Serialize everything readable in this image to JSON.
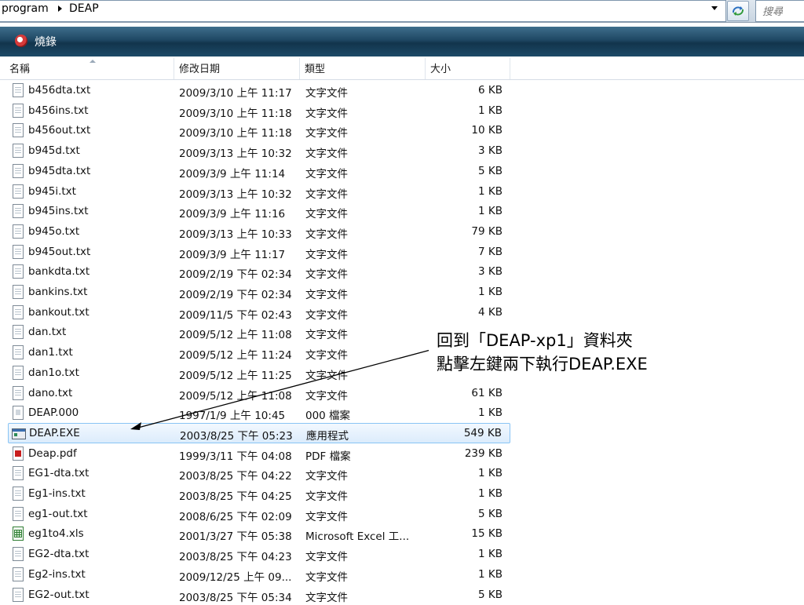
{
  "address": {
    "crumbs": [
      "program",
      "DEAP"
    ],
    "search_placeholder": "搜尋"
  },
  "toolbar": {
    "burn_label": "燒錄"
  },
  "columns": {
    "name": "名稱",
    "date": "修改日期",
    "type": "類型",
    "size": "大小"
  },
  "files": [
    {
      "name": "b456dta.txt",
      "date": "2009/3/10 上午 11:17",
      "type": "文字文件",
      "size": "6 KB",
      "icon": "text-file-icon"
    },
    {
      "name": "b456ins.txt",
      "date": "2009/3/10 上午 11:18",
      "type": "文字文件",
      "size": "1 KB",
      "icon": "text-file-icon"
    },
    {
      "name": "b456out.txt",
      "date": "2009/3/10 上午 11:18",
      "type": "文字文件",
      "size": "10 KB",
      "icon": "text-file-icon"
    },
    {
      "name": "b945d.txt",
      "date": "2009/3/13 上午 10:32",
      "type": "文字文件",
      "size": "3 KB",
      "icon": "text-file-icon"
    },
    {
      "name": "b945dta.txt",
      "date": "2009/3/9 上午 11:14",
      "type": "文字文件",
      "size": "5 KB",
      "icon": "text-file-icon"
    },
    {
      "name": "b945i.txt",
      "date": "2009/3/13 上午 10:32",
      "type": "文字文件",
      "size": "1 KB",
      "icon": "text-file-icon"
    },
    {
      "name": "b945ins.txt",
      "date": "2009/3/9 上午 11:16",
      "type": "文字文件",
      "size": "1 KB",
      "icon": "text-file-icon"
    },
    {
      "name": "b945o.txt",
      "date": "2009/3/13 上午 10:33",
      "type": "文字文件",
      "size": "79 KB",
      "icon": "text-file-icon"
    },
    {
      "name": "b945out.txt",
      "date": "2009/3/9 上午 11:17",
      "type": "文字文件",
      "size": "7 KB",
      "icon": "text-file-icon"
    },
    {
      "name": "bankdta.txt",
      "date": "2009/2/19 下午 02:34",
      "type": "文字文件",
      "size": "3 KB",
      "icon": "text-file-icon"
    },
    {
      "name": "bankins.txt",
      "date": "2009/2/19 下午 02:34",
      "type": "文字文件",
      "size": "1 KB",
      "icon": "text-file-icon"
    },
    {
      "name": "bankout.txt",
      "date": "2009/11/5 下午 02:43",
      "type": "文字文件",
      "size": "4 KB",
      "icon": "text-file-icon"
    },
    {
      "name": "dan.txt",
      "date": "2009/5/12 上午 11:08",
      "type": "文字文件",
      "size": "",
      "icon": "text-file-icon"
    },
    {
      "name": "dan1.txt",
      "date": "2009/5/12 上午 11:24",
      "type": "文字文件",
      "size": "",
      "icon": "text-file-icon"
    },
    {
      "name": "dan1o.txt",
      "date": "2009/5/12 上午 11:25",
      "type": "文字文件",
      "size": "",
      "icon": "text-file-icon"
    },
    {
      "name": "dano.txt",
      "date": "2009/5/12 上午 11:08",
      "type": "文字文件",
      "size": "61 KB",
      "icon": "text-file-icon"
    },
    {
      "name": "DEAP.000",
      "date": "1997/1/9 上午 10:45",
      "type": "000 檔案",
      "size": "1 KB",
      "icon": "generic-file-icon"
    },
    {
      "name": "DEAP.EXE",
      "date": "2003/8/25 下午 05:23",
      "type": "應用程式",
      "size": "549 KB",
      "icon": "application-icon",
      "selected": true
    },
    {
      "name": "Deap.pdf",
      "date": "1999/3/11 下午 04:08",
      "type": "PDF 檔案",
      "size": "239 KB",
      "icon": "pdf-file-icon"
    },
    {
      "name": "EG1-dta.txt",
      "date": "2003/8/25 下午 04:22",
      "type": "文字文件",
      "size": "1 KB",
      "icon": "text-file-icon"
    },
    {
      "name": "Eg1-ins.txt",
      "date": "2003/8/25 下午 04:25",
      "type": "文字文件",
      "size": "1 KB",
      "icon": "text-file-icon"
    },
    {
      "name": "eg1-out.txt",
      "date": "2008/6/25 下午 02:09",
      "type": "文字文件",
      "size": "5 KB",
      "icon": "text-file-icon"
    },
    {
      "name": "eg1to4.xls",
      "date": "2001/3/27 下午 05:38",
      "type": "Microsoft Excel 工...",
      "size": "15 KB",
      "icon": "excel-file-icon"
    },
    {
      "name": "EG2-dta.txt",
      "date": "2003/8/25 下午 04:23",
      "type": "文字文件",
      "size": "1 KB",
      "icon": "text-file-icon"
    },
    {
      "name": "Eg2-ins.txt",
      "date": "2009/12/25 上午 09...",
      "type": "文字文件",
      "size": "1 KB",
      "icon": "text-file-icon"
    },
    {
      "name": "EG2-out.txt",
      "date": "2003/8/25 下午 05:34",
      "type": "文字文件",
      "size": "5 KB",
      "icon": "text-file-icon"
    }
  ],
  "annotation": {
    "line1": "回到「DEAP-xp1」資料夾",
    "line2": "點擊左鍵兩下執行DEAP.EXE"
  },
  "colors": {
    "toolbar_dark": "#1e4763",
    "selection_border": "#89c4f4",
    "selection_fill": "#dcecfc"
  }
}
